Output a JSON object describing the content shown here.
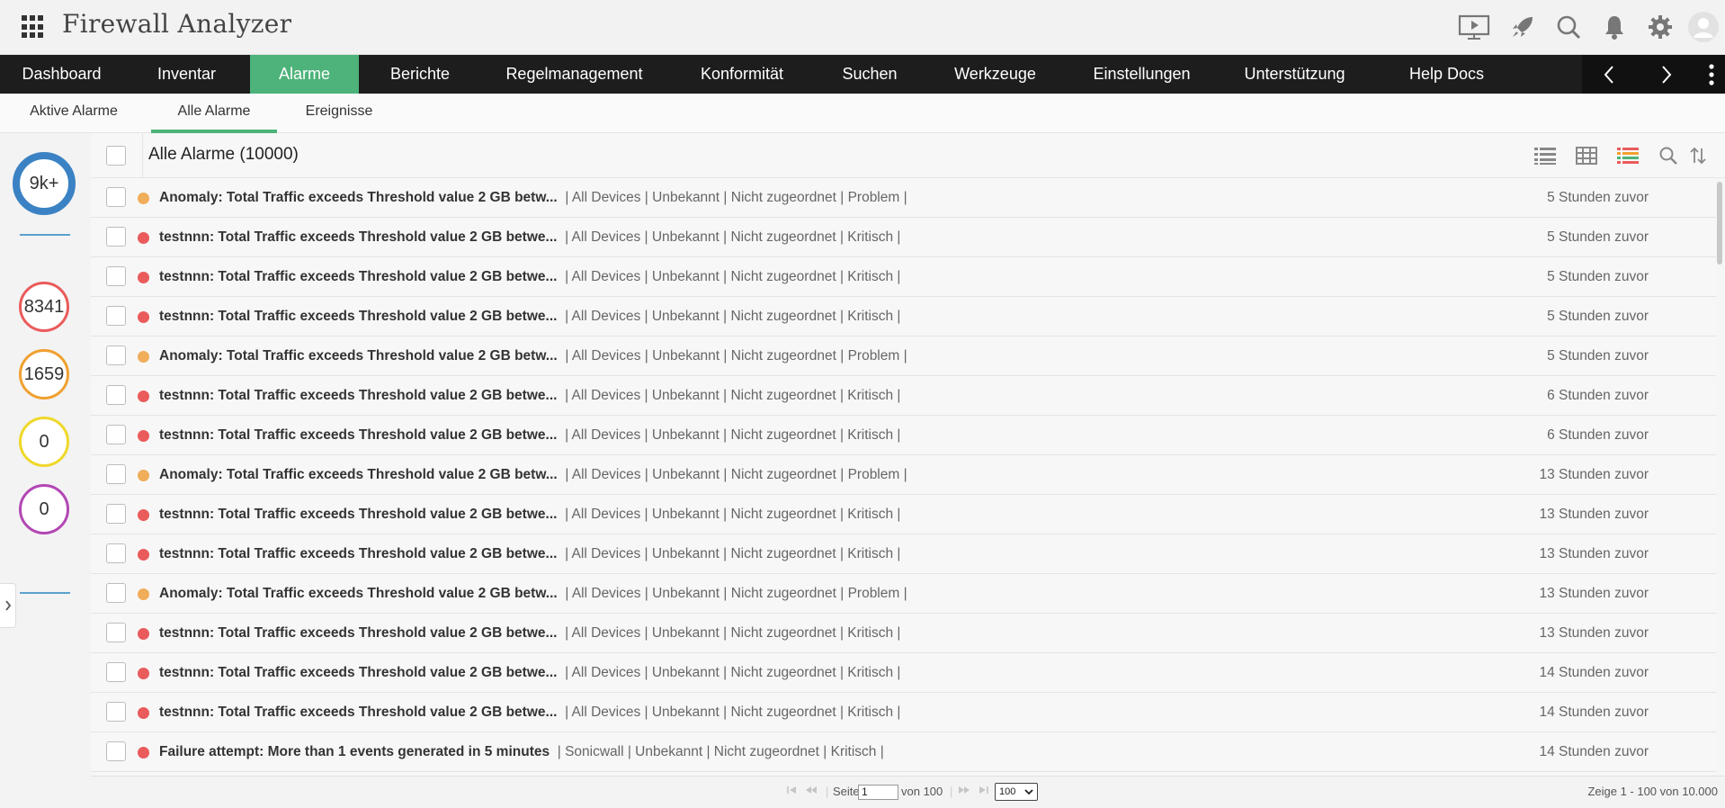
{
  "app": {
    "title": "Firewall Analyzer"
  },
  "header_icons": [
    "presentation-icon",
    "rocket-icon",
    "search-icon",
    "bell-icon",
    "gear-icon",
    "user-avatar"
  ],
  "nav": {
    "items": [
      "Dashboard",
      "Inventar",
      "Alarme",
      "Berichte",
      "Regelmanagement",
      "Konformität",
      "Suchen",
      "Werkzeuge",
      "Einstellungen",
      "Unterstützung",
      "Help Docs"
    ],
    "active": "Alarme"
  },
  "subtabs": {
    "items": [
      "Aktive Alarme",
      "Alle Alarme",
      "Ereignisse"
    ],
    "active": "Alle Alarme"
  },
  "summary": {
    "total": "9k+",
    "critical": "8341",
    "problem": "1659",
    "warning": "0",
    "attention": "0"
  },
  "list": {
    "title": "Alle Alarme (10000)",
    "rows": [
      {
        "name": "Anomaly: Total Traffic exceeds Threshold value 2 GB betw...",
        "meta": "| All Devices | Unbekannt | Nicht zugeordnet | Problem |",
        "time": "5 Stunden zuvor",
        "severity": "problem"
      },
      {
        "name": "testnnn: Total Traffic exceeds Threshold value 2 GB betwe...",
        "meta": "| All Devices | Unbekannt | Nicht zugeordnet | Kritisch |",
        "time": "5 Stunden zuvor",
        "severity": "critical"
      },
      {
        "name": "testnnn: Total Traffic exceeds Threshold value 2 GB betwe...",
        "meta": "| All Devices | Unbekannt | Nicht zugeordnet | Kritisch |",
        "time": "5 Stunden zuvor",
        "severity": "critical"
      },
      {
        "name": "testnnn: Total Traffic exceeds Threshold value 2 GB betwe...",
        "meta": "| All Devices | Unbekannt | Nicht zugeordnet | Kritisch |",
        "time": "5 Stunden zuvor",
        "severity": "critical"
      },
      {
        "name": "Anomaly: Total Traffic exceeds Threshold value 2 GB betw...",
        "meta": "| All Devices | Unbekannt | Nicht zugeordnet | Problem |",
        "time": "5 Stunden zuvor",
        "severity": "problem"
      },
      {
        "name": "testnnn: Total Traffic exceeds Threshold value 2 GB betwe...",
        "meta": "| All Devices | Unbekannt | Nicht zugeordnet | Kritisch |",
        "time": "6 Stunden zuvor",
        "severity": "critical"
      },
      {
        "name": "testnnn: Total Traffic exceeds Threshold value 2 GB betwe...",
        "meta": "| All Devices | Unbekannt | Nicht zugeordnet | Kritisch |",
        "time": "6 Stunden zuvor",
        "severity": "critical"
      },
      {
        "name": "Anomaly: Total Traffic exceeds Threshold value 2 GB betw...",
        "meta": "| All Devices | Unbekannt | Nicht zugeordnet | Problem |",
        "time": "13 Stunden zuvor",
        "severity": "problem"
      },
      {
        "name": "testnnn: Total Traffic exceeds Threshold value 2 GB betwe...",
        "meta": "| All Devices | Unbekannt | Nicht zugeordnet | Kritisch |",
        "time": "13 Stunden zuvor",
        "severity": "critical"
      },
      {
        "name": "testnnn: Total Traffic exceeds Threshold value 2 GB betwe...",
        "meta": "| All Devices | Unbekannt | Nicht zugeordnet | Kritisch |",
        "time": "13 Stunden zuvor",
        "severity": "critical"
      },
      {
        "name": "Anomaly: Total Traffic exceeds Threshold value 2 GB betw...",
        "meta": "| All Devices | Unbekannt | Nicht zugeordnet | Problem |",
        "time": "13 Stunden zuvor",
        "severity": "problem"
      },
      {
        "name": "testnnn: Total Traffic exceeds Threshold value 2 GB betwe...",
        "meta": "| All Devices | Unbekannt | Nicht zugeordnet | Kritisch |",
        "time": "13 Stunden zuvor",
        "severity": "critical"
      },
      {
        "name": "testnnn: Total Traffic exceeds Threshold value 2 GB betwe...",
        "meta": "| All Devices | Unbekannt | Nicht zugeordnet | Kritisch |",
        "time": "14 Stunden zuvor",
        "severity": "critical"
      },
      {
        "name": "testnnn: Total Traffic exceeds Threshold value 2 GB betwe...",
        "meta": "| All Devices | Unbekannt | Nicht zugeordnet | Kritisch |",
        "time": "14 Stunden zuvor",
        "severity": "critical"
      },
      {
        "name": "Failure attempt: More than 1 events generated in 5 minutes",
        "meta": "| Sonicwall | Unbekannt | Nicht zugeordnet | Kritisch |",
        "time": "14 Stunden zuvor",
        "severity": "critical"
      }
    ]
  },
  "pager": {
    "page_label": "Seite",
    "page_value": "1",
    "of_label": "von 100",
    "per_page": "100",
    "summary": "Zeige 1 - 100 von 10.000"
  },
  "colors": {
    "accent": "#4db37a",
    "critical": "#ea5b5b",
    "problem": "#f0ad5a",
    "warning": "#efd82a",
    "attention": "#b247b4",
    "total": "#3a82c4"
  }
}
